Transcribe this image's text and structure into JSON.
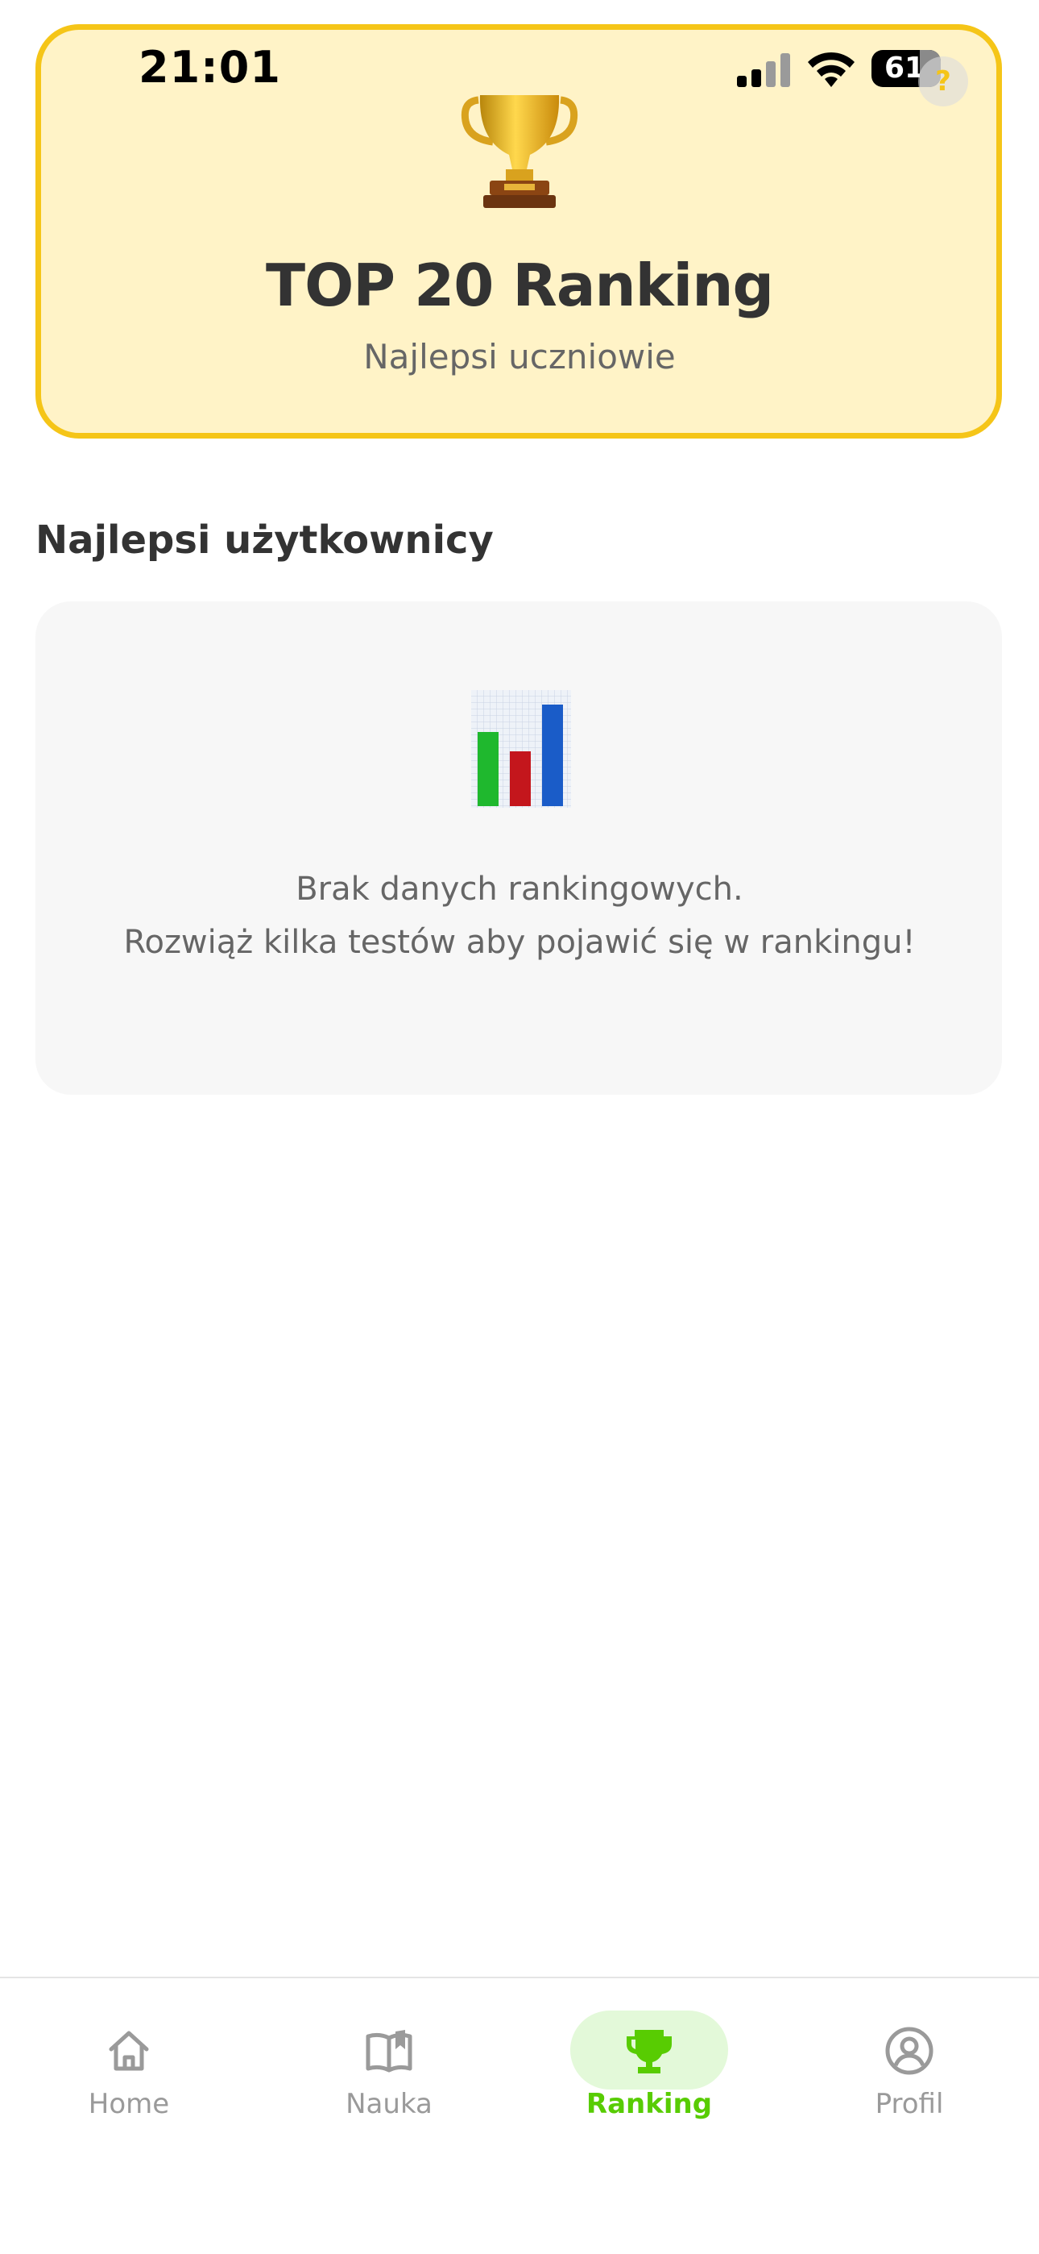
{
  "status_bar": {
    "time": "21:01",
    "battery": "61"
  },
  "header": {
    "help_label": "?",
    "title": "TOP 20 Ranking",
    "subtitle": "Najlepsi uczniowie"
  },
  "section": {
    "title": "Najlepsi użytkownicy"
  },
  "empty_state": {
    "line1": "Brak danych rankingowych.",
    "line2": "Rozwiąż kilka testów aby pojawić się w rankingu!"
  },
  "nav": {
    "items": [
      {
        "label": "Home",
        "icon": "home-icon"
      },
      {
        "label": "Nauka",
        "icon": "book-icon"
      },
      {
        "label": "Ranking",
        "icon": "trophy-icon",
        "active": true
      },
      {
        "label": "Profil",
        "icon": "user-circle-icon"
      }
    ]
  },
  "colors": {
    "accent_green": "#58CC02",
    "active_pill": "#E3F9D9",
    "hero_bg": "#FFF3C7",
    "hero_border": "#F5C518",
    "text_dark": "#333333",
    "text_muted": "#666666",
    "nav_inactive": "#9A9A9A"
  }
}
